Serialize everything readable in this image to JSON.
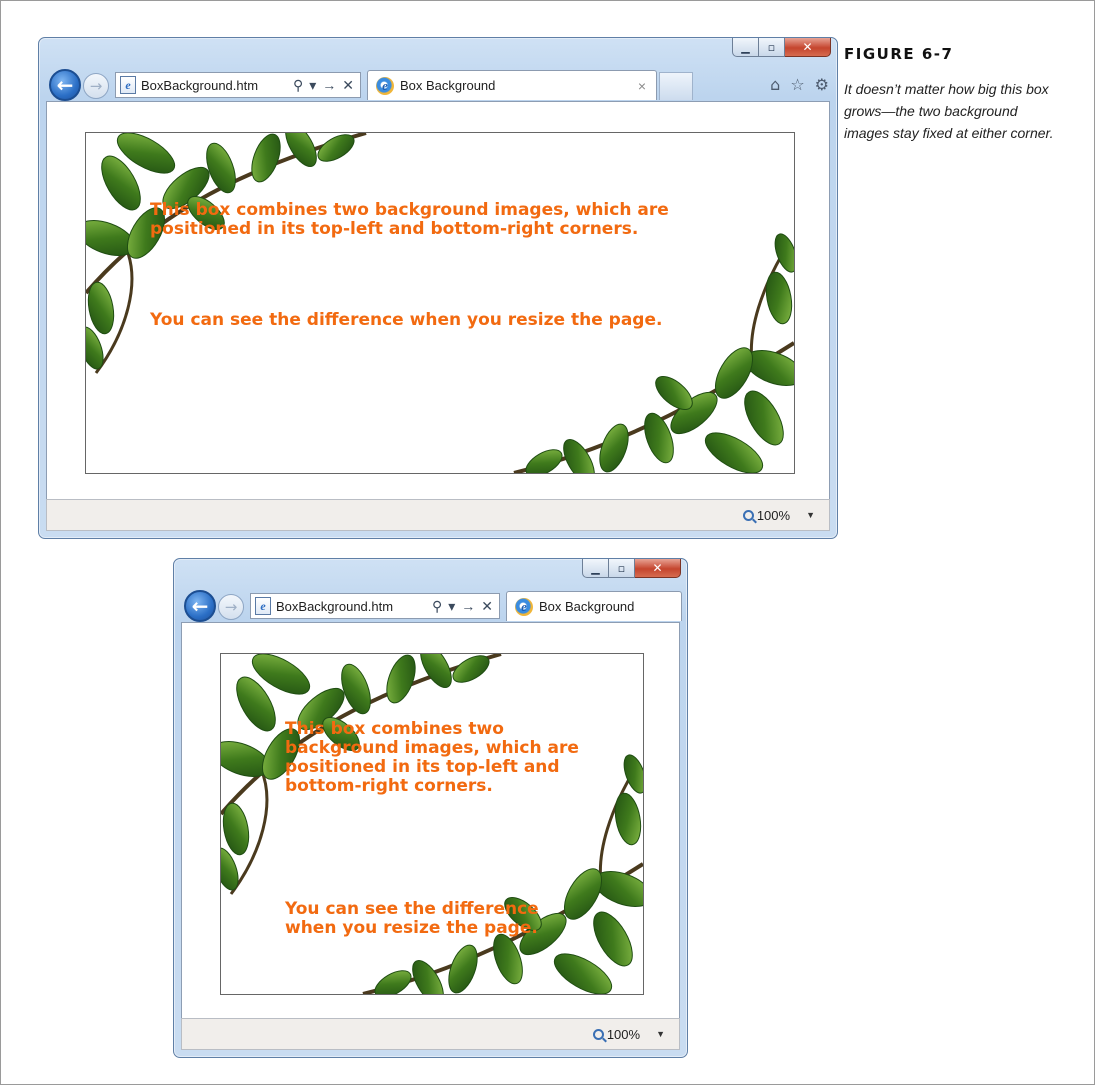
{
  "figure": {
    "label": "FIGURE 6-7",
    "caption": "It doesn’t matter how big this box grows—the two background images stay fixed at either corner."
  },
  "window_wide": {
    "address": "BoxBackground.htm",
    "tab_title": "Box Background",
    "tab_close": "×",
    "zoom": "100%",
    "paragraph1": "This box combines two background images, which are positioned in its top-left and bottom-right corners.",
    "paragraph2": "You can see the difference when you resize the page."
  },
  "window_narrow": {
    "address": "BoxBackground.htm",
    "tab_title": "Box Background",
    "zoom": "100%",
    "paragraph1": "This box combines two background images, which are positioned in its top-left and bottom-right corners.",
    "paragraph2": "You can see the difference when you resize the page."
  },
  "icons": {
    "back": "back-arrow-icon",
    "forward": "forward-arrow-icon",
    "home": "home-icon",
    "favorites": "star-icon",
    "tools": "gear-icon",
    "search": "search-icon",
    "refresh": "refresh-icon",
    "stop": "stop-icon",
    "zoom": "zoom-icon"
  },
  "colors": {
    "text_accent": "#f26a10",
    "leaf_dark": "#1f4d12",
    "leaf_mid": "#3f7a1c",
    "leaf_light": "#7fb03a",
    "branch": "#4a3a1e"
  }
}
